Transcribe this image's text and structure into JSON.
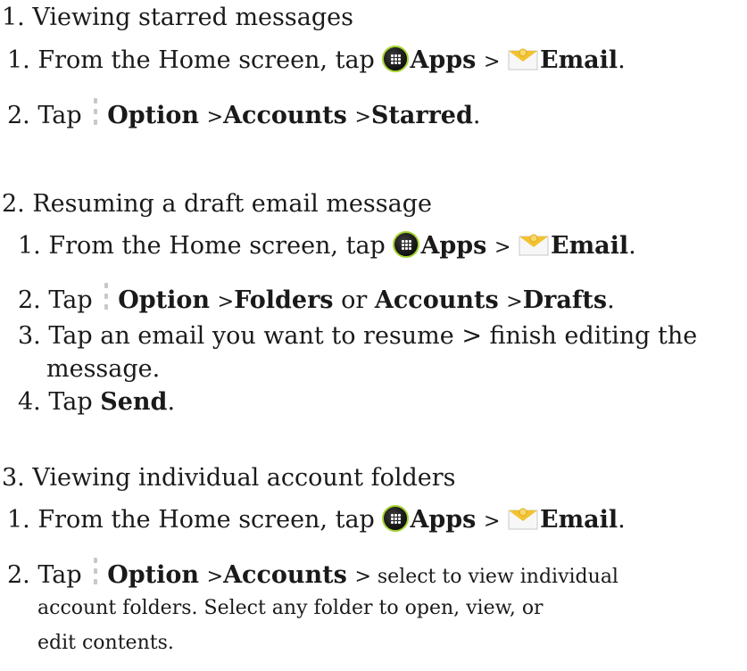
{
  "sections": [
    {
      "heading": "1. Viewing starred messages",
      "steps": [
        {
          "num": "1.",
          "pre": "From the Home screen, tap",
          "apps": "Apps",
          "sep": ">",
          "email": "Email",
          "end": "."
        },
        {
          "num": "2.",
          "pre": "Tap",
          "option": "Option",
          "sep1": ">",
          "b1": "Accounts",
          "sep2": ">",
          "b2": "Starred",
          "end": "."
        }
      ]
    },
    {
      "heading": "2. Resuming a draft email message",
      "steps": [
        {
          "num": "1.",
          "pre": "From the Home screen, tap",
          "apps": "Apps",
          "sep": ">",
          "email": "Email",
          "end": "."
        },
        {
          "num": "2.",
          "pre": "Tap",
          "option": "Option",
          "sep1": ">",
          "b1": "Folders",
          "mid": "or",
          "b2": "Accounts",
          "sep2": ">",
          "b3": "Drafts",
          "end": "."
        },
        {
          "num": "3.",
          "text1": "Tap an email you want to resume > finish editing the",
          "text2": "message."
        },
        {
          "num": "4.",
          "pre": "Tap",
          "b1": "Send",
          "end": "."
        }
      ]
    },
    {
      "heading": "3. Viewing individual account folders",
      "steps": [
        {
          "num": "1.",
          "pre": "From the Home screen, tap",
          "apps": "Apps",
          "sep": ">",
          "email": "Email",
          "end": "."
        },
        {
          "num": "2.",
          "pre": "Tap",
          "option": "Option",
          "sep1": ">",
          "b1": "Accounts",
          "rest1": "> select to view individual",
          "rest2": "account folders. Select any folder to open, view, or",
          "rest3": "edit contents."
        }
      ]
    }
  ],
  "icons": {
    "apps": "apps-icon",
    "email": "email-icon",
    "option": "option-menu-icon"
  },
  "colors": {
    "apps_ring": "#a6d431",
    "email_flap": "#f2c230"
  }
}
